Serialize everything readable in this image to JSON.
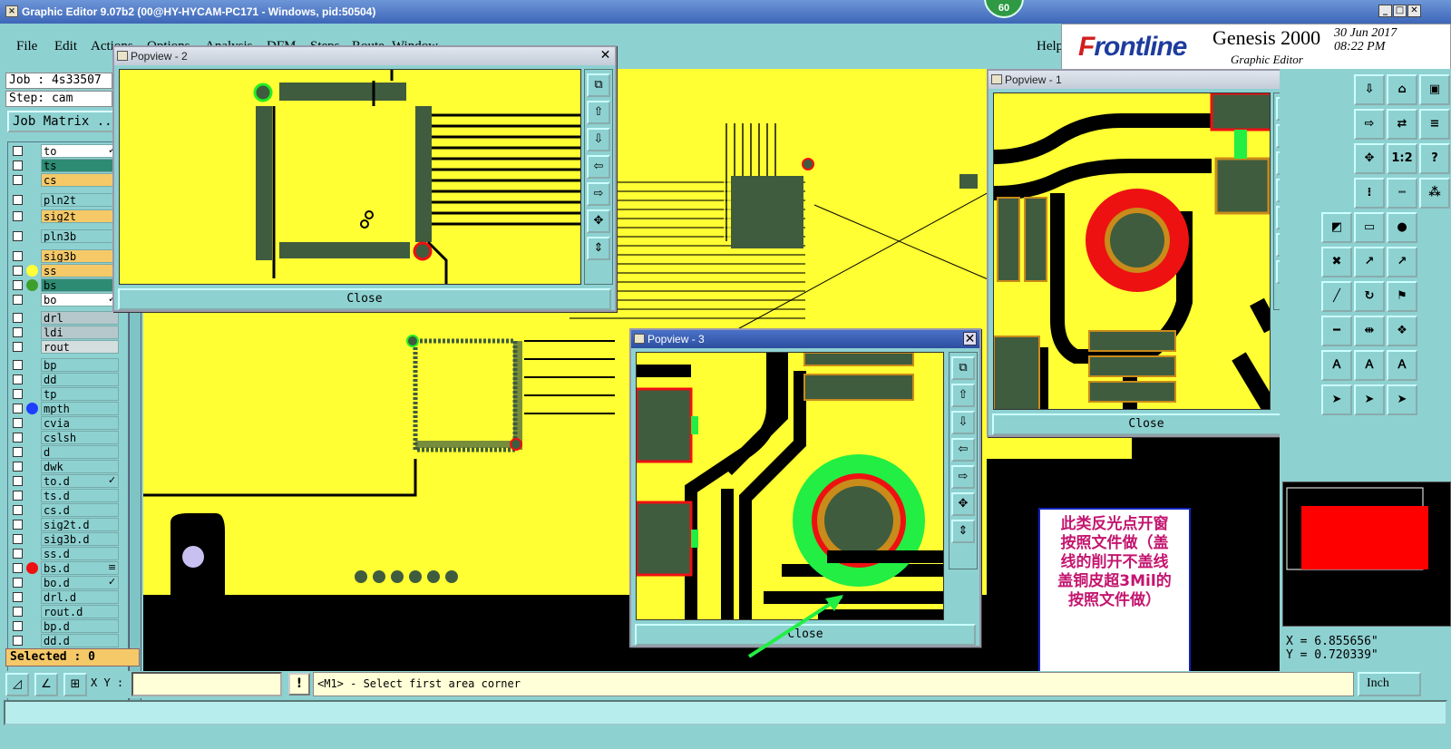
{
  "window": {
    "title": "Graphic Editor 9.07b2 (00@HY-HYCAM-PC171 - Windows, pid:50504)",
    "badge": "60"
  },
  "menu": {
    "items": [
      "File",
      "Edit",
      "Actions",
      "Options",
      "Analysis",
      "DFM",
      "Steps",
      "Route",
      "Window"
    ],
    "help": "Help"
  },
  "brand": {
    "logo_a": "F",
    "logo_b": "rontline",
    "product": "Genesis 2000",
    "subtitle": "Graphic Editor",
    "date": "30 Jun 2017",
    "time": "08:22 PM"
  },
  "job": {
    "job": "Job : 4s33507",
    "step": "Step: cam",
    "matrix": "Job Matrix ..."
  },
  "layers": [
    {
      "name": "to",
      "color": "#ffffff",
      "dot": "",
      "mark": "✓"
    },
    {
      "name": "ts",
      "color": "#2e8b73",
      "dot": "",
      "mark": ""
    },
    {
      "name": "cs",
      "color": "#f5c968",
      "dot": "",
      "mark": ""
    },
    {
      "name": "pln2t",
      "color": "#8ed1d1",
      "dot": "",
      "mark": ""
    },
    {
      "name": "sig2t",
      "color": "#f5c968",
      "dot": "",
      "mark": ""
    },
    {
      "name": "pln3b",
      "color": "#8ed1d1",
      "dot": "",
      "mark": ""
    },
    {
      "name": "sig3b",
      "color": "#f5c968",
      "dot": "",
      "mark": ""
    },
    {
      "name": "ss",
      "color": "#f5c968",
      "dot": "#ffff3a",
      "mark": ""
    },
    {
      "name": "bs",
      "color": "#2e8b73",
      "dot": "#3c9f2c",
      "mark": ""
    },
    {
      "name": "bo",
      "color": "#ffffff",
      "dot": "",
      "mark": "✓"
    },
    {
      "name": "drl",
      "color": "#b6c8cc",
      "dot": "",
      "mark": ""
    },
    {
      "name": "ldi",
      "color": "#b6c8cc",
      "dot": "",
      "mark": ""
    },
    {
      "name": "rout",
      "color": "#d4dede",
      "dot": "",
      "mark": ""
    },
    {
      "name": "bp",
      "color": "#8ed1d1",
      "dot": "",
      "mark": ""
    },
    {
      "name": "dd",
      "color": "#8ed1d1",
      "dot": "",
      "mark": ""
    },
    {
      "name": "tp",
      "color": "#8ed1d1",
      "dot": "",
      "mark": ""
    },
    {
      "name": "mpth",
      "color": "#8ed1d1",
      "dot": "#1f3fff",
      "mark": ""
    },
    {
      "name": "cvia",
      "color": "#8ed1d1",
      "dot": "",
      "mark": ""
    },
    {
      "name": "cslsh",
      "color": "#8ed1d1",
      "dot": "",
      "mark": ""
    },
    {
      "name": "d",
      "color": "#8ed1d1",
      "dot": "",
      "mark": ""
    },
    {
      "name": "dwk",
      "color": "#8ed1d1",
      "dot": "",
      "mark": ""
    },
    {
      "name": "to.d",
      "color": "#8ed1d1",
      "dot": "",
      "mark": "✓"
    },
    {
      "name": "ts.d",
      "color": "#8ed1d1",
      "dot": "",
      "mark": ""
    },
    {
      "name": "cs.d",
      "color": "#8ed1d1",
      "dot": "",
      "mark": ""
    },
    {
      "name": "sig2t.d",
      "color": "#8ed1d1",
      "dot": "",
      "mark": ""
    },
    {
      "name": "sig3b.d",
      "color": "#8ed1d1",
      "dot": "",
      "mark": ""
    },
    {
      "name": "ss.d",
      "color": "#8ed1d1",
      "dot": "",
      "mark": ""
    },
    {
      "name": "bs.d",
      "color": "#8ed1d1",
      "dot": "#ee1111",
      "mark": "≡"
    },
    {
      "name": "bo.d",
      "color": "#8ed1d1",
      "dot": "",
      "mark": "✓"
    },
    {
      "name": "drl.d",
      "color": "#8ed1d1",
      "dot": "",
      "mark": ""
    },
    {
      "name": "rout.d",
      "color": "#8ed1d1",
      "dot": "",
      "mark": ""
    },
    {
      "name": "bp.d",
      "color": "#8ed1d1",
      "dot": "",
      "mark": ""
    },
    {
      "name": "dd.d",
      "color": "#8ed1d1",
      "dot": "",
      "mark": ""
    }
  ],
  "selected": "Selected : 0",
  "popviews": {
    "p1": {
      "title": "Popview - 1",
      "close": "Close"
    },
    "p2": {
      "title": "Popview - 2",
      "close": "Close"
    },
    "p3": {
      "title": "Popview - 3",
      "close": "Close"
    }
  },
  "coords": {
    "x": "X = 6.855656\"",
    "y": "Y = 0.720339\""
  },
  "bottom": {
    "xy_label": "X Y :",
    "warn": "!",
    "prompt": "<M1> - Select first area corner",
    "unit": "Inch"
  },
  "note": {
    "lines": [
      "此类反光点开窗",
      "按照文件做（盖",
      "线的削开不盖线",
      "盖铜皮超3Mil的",
      "按照文件做）"
    ]
  },
  "colors": {
    "board": "#ffff33",
    "copper": "#3f5c3f",
    "pad_ring": "#c98b1a",
    "solder_open": "#ee1111",
    "highlight": "#22ee44",
    "ui_teal": "#8ed1d1"
  },
  "right_tools": [
    "1:2",
    "?"
  ]
}
